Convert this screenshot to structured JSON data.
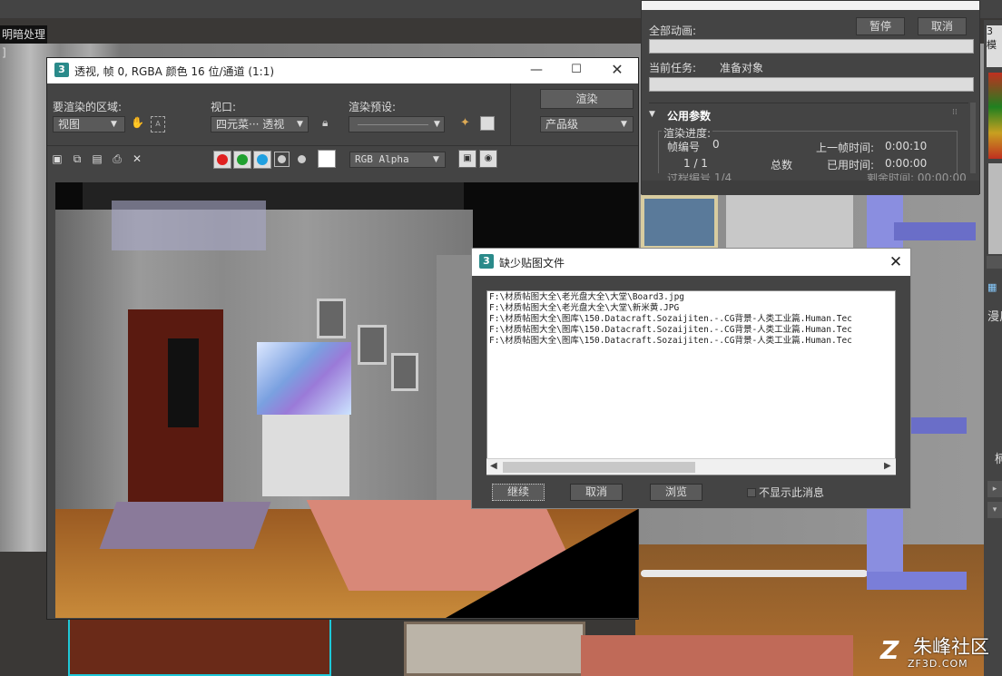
{
  "viewport": {
    "label": "明暗处理 ]"
  },
  "command_panel": {
    "tab": "3 模",
    "text1": "漫反",
    "text2": "楠"
  },
  "render_progress": {
    "all_animation": "全部动画:",
    "pause": "暂停",
    "cancel": "取消",
    "current_task_label": "当前任务:",
    "current_task_value": "准备对象",
    "common_params": "公用参数",
    "progress_label": "渲染进度:",
    "frame_label": "帧编号",
    "frame_value": "0",
    "last_frame_label": "上一帧时间:",
    "last_frame_value": "0:00:10",
    "count": "1 / 1",
    "total": "总数",
    "elapsed_label": "已用时间:",
    "elapsed_value": "0:00:00",
    "cut_left": "过程编号 1/4",
    "cut_right": "剩余时间: 00:00:00",
    "pct_all": 0,
    "pct_task": 0
  },
  "frame_window": {
    "title": "透视, 帧 0, RGBA 颜色 16 位/通道 (1:1)",
    "area_label": "要渲染的区域:",
    "area_value": "视图",
    "viewport_label": "视口:",
    "viewport_value": "四元菜··· 透视",
    "preset_label": "渲染预设:",
    "render_button": "渲染",
    "product_level": "产品级",
    "channel": "RGB Alpha",
    "colors": {
      "red": "#e02020",
      "green": "#20a030",
      "blue": "#20a0e0"
    }
  },
  "missing_maps_dialog": {
    "title": "缺少贴图文件",
    "items": [
      "F:\\材质帖图大全\\老光盘大全\\大堂\\Board3.jpg",
      "F:\\材质帖图大全\\老光盘大全\\大堂\\新米黄.JPG",
      "F:\\材质帖图大全\\图库\\150.Datacraft.Sozaijiten.-.CG背景-人类工业篇.Human.Tec",
      "F:\\材质帖图大全\\图库\\150.Datacraft.Sozaijiten.-.CG背景-人类工业篇.Human.Tec",
      "F:\\材质帖图大全\\图库\\150.Datacraft.Sozaijiten.-.CG背景-人类工业篇.Human.Tec"
    ],
    "continue": "继续",
    "cancel": "取消",
    "browse": "浏览",
    "dont_show": "不显示此消息"
  },
  "watermark": {
    "name": "朱峰社区",
    "url": "ZF3D.COM"
  }
}
